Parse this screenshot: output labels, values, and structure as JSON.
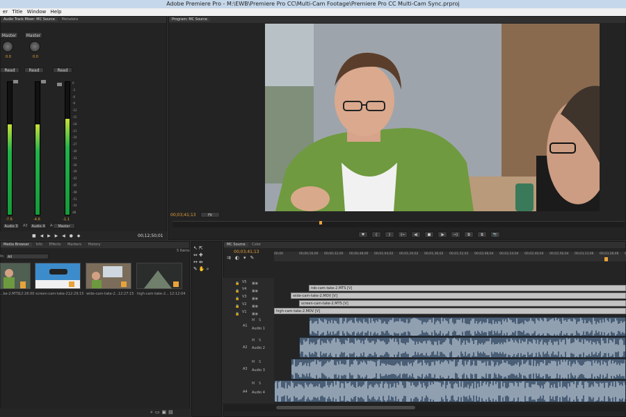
{
  "window": {
    "title": "Adobe Premiere Pro - M:\\EWB\\Premiere Pro CC\\Multi-Cam Footage\\Premiere Pro CC Multi-Cam Sync.prproj"
  },
  "menu": [
    "er",
    "Title",
    "Window",
    "Help"
  ],
  "mixer": {
    "tabs": [
      "Audio Track Mixer: MC Source",
      "Metadata"
    ],
    "channel_headers": [
      "Master",
      "Master"
    ],
    "knob_values": [
      "0.0",
      "0.0"
    ],
    "mode_labels": [
      "Read",
      "Read",
      "Read"
    ],
    "meter_values": [
      "-7.6",
      "-4.6",
      "-1.1"
    ],
    "channel_names": [
      "Audio 3",
      "Audio 4",
      "Master"
    ],
    "channel_prefixes": [
      "A3",
      "A4"
    ],
    "timecode": "00;12;50;01",
    "scale": [
      "0",
      "-3",
      "-6",
      "-9",
      "-12",
      "-15",
      "-18",
      "-21",
      "-24",
      "-27",
      "-30",
      "-33",
      "-36",
      "-39",
      "-42",
      "-45",
      "-48",
      "-51",
      "-54",
      "dB"
    ]
  },
  "program": {
    "tab": "Program: MC Source",
    "timecode": "00;03;41;13",
    "fit": "Fit"
  },
  "project": {
    "tabs": [
      "Media Browser",
      "Info",
      "Effects",
      "Markers",
      "History"
    ],
    "items_count": "5 Items",
    "in_label": "In:",
    "in_value": "All",
    "thumbs": [
      {
        "name": "...ke-2.MTS",
        "duration": "12:26:00"
      },
      {
        "name": "screen-cam-take-2...",
        "duration": "12:29:15"
      },
      {
        "name": "wide-cam-take-2...",
        "duration": "12:27:15"
      },
      {
        "name": "high-cam-take-2...",
        "duration": "12:12:04"
      }
    ]
  },
  "timeline": {
    "tabs": [
      "MC Source",
      "Color"
    ],
    "timecode": "00;03;41;13",
    "ruler": [
      "00;00",
      "00;00;16;00",
      "00;00;32;00",
      "00;00;48;00",
      "00;01;04;02",
      "00;01;20;02",
      "00;01;36;02",
      "00;01;52;02",
      "00;02;08;04",
      "00;02;24;04",
      "00;02;40;04",
      "00;02;56;04",
      "00;03;12;06",
      "00;03;28;06",
      "00;03;44;06"
    ],
    "video_tracks": [
      "V4",
      "V3",
      "V2",
      "V1"
    ],
    "video_clips": [
      "rob-cam-take-2.MTS [V]",
      "wide-cam-take-2.MOV [V]",
      "screen-cam-take-2.MTS [V]",
      "high-cam-take-2.MOV [V]"
    ],
    "audio_tracks": [
      {
        "id": "A1",
        "name": "Audio 1"
      },
      {
        "id": "A2",
        "name": "Audio 2"
      },
      {
        "id": "A3",
        "name": "Audio 3"
      },
      {
        "id": "A4",
        "name": "Audio 4"
      }
    ],
    "top_track": "V5",
    "toggle_m": "M",
    "toggle_s": "S"
  },
  "transport": [
    "♥",
    "{",
    "}",
    "{←",
    "◀|",
    "■",
    "|▶",
    "→}",
    "⧉",
    "⧉",
    "📷"
  ],
  "colors": {
    "accent": "#e8a33a",
    "clip_audio": "#4a5f76",
    "clip_video": "#c3c3c3"
  }
}
